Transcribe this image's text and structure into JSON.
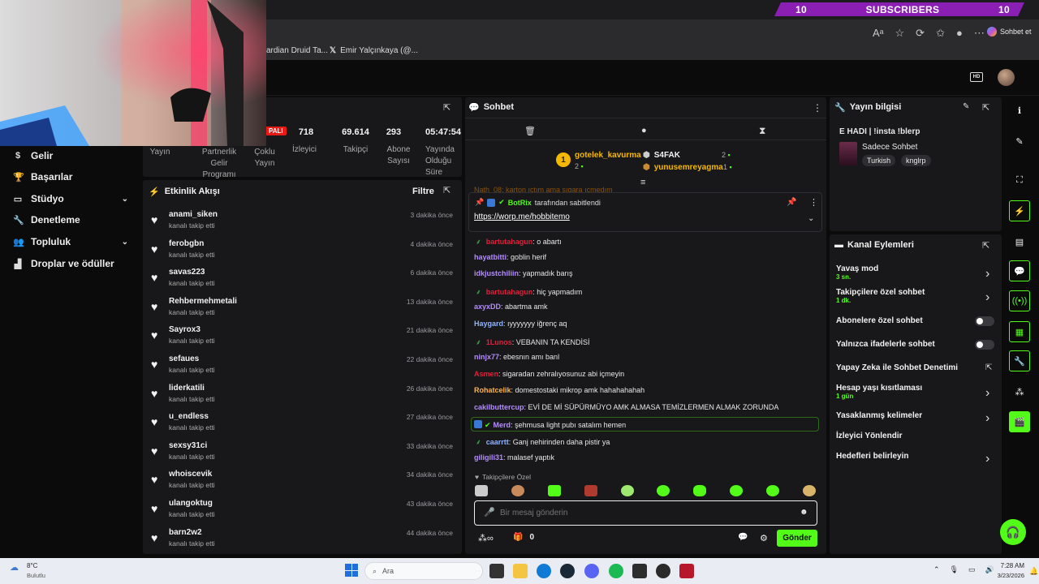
{
  "browser": {
    "subscribers_banner": {
      "left": "10",
      "label": "SUBSCRIBERS",
      "right": "10"
    },
    "bookmarks": [
      "ardian Druid Ta...",
      "Emir Yalçınkaya (@..."
    ],
    "copilot_label": "Sohbet et"
  },
  "nav": {
    "items": [
      {
        "label": "Gelir",
        "icon": "dollar-icon"
      },
      {
        "label": "Başarılar",
        "icon": "trophy-icon"
      },
      {
        "label": "Stüdyo",
        "icon": "studio-icon",
        "expandable": true
      },
      {
        "label": "Denetleme",
        "icon": "wrench-icon"
      },
      {
        "label": "Topluluk",
        "icon": "community-icon",
        "expandable": true
      },
      {
        "label": "Droplar ve ödüller",
        "icon": "drops-icon"
      }
    ]
  },
  "stats": {
    "status_badge": "PALI",
    "items": [
      {
        "value": "",
        "label": "Yayın"
      },
      {
        "value": "",
        "label": "Partnerlik Gelir Programı"
      },
      {
        "value": "",
        "label": "Çoklu Yayın"
      },
      {
        "value": "718",
        "label": "İzleyici"
      },
      {
        "value": "69.614",
        "label": "Takipçi"
      },
      {
        "value": "293",
        "label": "Abone Sayısı"
      },
      {
        "value": "05:47:54",
        "label": "Yayında Olduğu Süre"
      }
    ]
  },
  "activity": {
    "title": "Etkinlik Akışı",
    "filter_label": "Filtre",
    "items": [
      {
        "user": "anami_siken",
        "action": "kanalı takip etti",
        "time": "3 dakika önce"
      },
      {
        "user": "ferobgbn",
        "action": "kanalı takip etti",
        "time": "4 dakika önce"
      },
      {
        "user": "savas223",
        "action": "kanalı takip etti",
        "time": "6 dakika önce"
      },
      {
        "user": "Rehbermehmetali",
        "action": "kanalı takip etti",
        "time": "13 dakika önce"
      },
      {
        "user": "Sayrox3",
        "action": "kanalı takip etti",
        "time": "21 dakika önce"
      },
      {
        "user": "sefaues",
        "action": "kanalı takip etti",
        "time": "22 dakika önce"
      },
      {
        "user": "liderkatili",
        "action": "kanalı takip etti",
        "time": "26 dakika önce"
      },
      {
        "user": "u_endless",
        "action": "kanalı takip etti",
        "time": "27 dakika önce"
      },
      {
        "user": "sexsy31ci",
        "action": "kanalı takip etti",
        "time": "33 dakika önce"
      },
      {
        "user": "whoiscevik",
        "action": "kanalı takip etti",
        "time": "34 dakika önce"
      },
      {
        "user": "ulangoktug",
        "action": "kanalı takip etti",
        "time": "43 dakika önce"
      },
      {
        "user": "barn2w2",
        "action": "kanalı takip etti",
        "time": "44 dakika önce"
      }
    ]
  },
  "chat": {
    "title": "Sohbet",
    "leaderboard": [
      {
        "rank": "1",
        "user": "gotelek_kavurma",
        "count": "2"
      },
      {
        "user": "S4FAK",
        "count": "2"
      },
      {
        "user": "yunusemreyagma",
        "count": "1"
      }
    ],
    "partial_top": "Nath_08: karton ıçtım ama sıgara ıçmedım",
    "pinned": {
      "by_user": "BotRix",
      "by_suffix": "tarafından sabitlendi",
      "link": "https://worp.me/hobbitemo"
    },
    "messages": [
      {
        "user": "bartutahagun",
        "color": "#e0203a",
        "text": ": o abartı",
        "badge": true
      },
      {
        "user": "hayatbitti",
        "color": "#b48cff",
        "text": ": goblin herif"
      },
      {
        "user": "idkjustchiliin",
        "color": "#b48cff",
        "text": ": yapmadık barış"
      },
      {
        "user": "bartutahagun",
        "color": "#e0203a",
        "text": ": hiç yapmadım",
        "badge": true
      },
      {
        "user": "axyxDD",
        "color": "#b48cff",
        "text": ": abartma amk"
      },
      {
        "user": "Haygard",
        "color": "#8fb3ff",
        "text": ": ıyyyyyyy iğrenç aq"
      },
      {
        "user": "1Lunos",
        "color": "#e0203a",
        "text": ": VEBANIN TA KENDİSİ",
        "badge": true
      },
      {
        "user": "ninjx77",
        "color": "#b48cff",
        "text": ": ebesnın amı banl"
      },
      {
        "user": "Asmen",
        "color": "#e0203a",
        "text": ": sigaradan zehralıyosunuz abi içmeyin"
      },
      {
        "user": "Rohatcelik",
        "color": "#ffb347",
        "text": ": domestostaki mikrop amk hahahahahah"
      },
      {
        "user": "cakilbuttercup",
        "color": "#b48cff",
        "text": ": EVİ DE Mİ SÜPÜRMÜYO AMK ALMASA TEMİZLERMEN ALMAK ZORUNDA"
      },
      {
        "user": "Merd",
        "color": "#b48cff",
        "text": ": şehmusa light pubı satalım hemen",
        "highlight": true
      },
      {
        "user": "caarrtt",
        "color": "#8fb3ff",
        "text": ": Ganj nehirinden daha pistir ya",
        "badge": true
      },
      {
        "user": "giligili31",
        "color": "#b48cff",
        "text": ": malasef yaptık"
      }
    ],
    "followers_only_label": "Takipçilere Özel",
    "input_placeholder": "Bir mesaj gönderin",
    "points": "0",
    "send_label": "Gönder"
  },
  "stream_info": {
    "title": "Yayın bilgisi",
    "stream_title": "E HADI | !insta !blerp",
    "category": "Sadece Sohbet",
    "tags": [
      "Turkish",
      "knglrp"
    ]
  },
  "channel_actions": {
    "title": "Kanal Eylemleri",
    "items": [
      {
        "label": "Yavaş mod",
        "sub": "3 sn.",
        "type": "chevron"
      },
      {
        "label": "Takipçilere özel sohbet",
        "sub": "1 dk.",
        "type": "chevron"
      },
      {
        "label": "Abonelere özel sohbet",
        "type": "toggle"
      },
      {
        "label": "Yalnızca ifadelerle sohbet",
        "type": "toggle"
      },
      {
        "label": "Yapay Zeka ile Sohbet Denetimi",
        "type": "external"
      },
      {
        "label": "Hesap yaşı kısıtlaması",
        "sub": "1 gün",
        "type": "chevron"
      },
      {
        "label": "Yasaklanmış kelimeler",
        "type": "chevron"
      },
      {
        "label": "İzleyici Yönlendir",
        "type": "none"
      },
      {
        "label": "Hedefleri belirleyin",
        "type": "chevron"
      }
    ]
  },
  "taskbar": {
    "weather_temp": "8°C",
    "weather_desc": "Bulutlu",
    "search_placeholder": "Ara",
    "time": "7:28 AM",
    "date": "3/23/2026"
  },
  "colors": {
    "accent": "#53fc18",
    "panel": "#18181a",
    "bg": "#0b0b0c"
  }
}
